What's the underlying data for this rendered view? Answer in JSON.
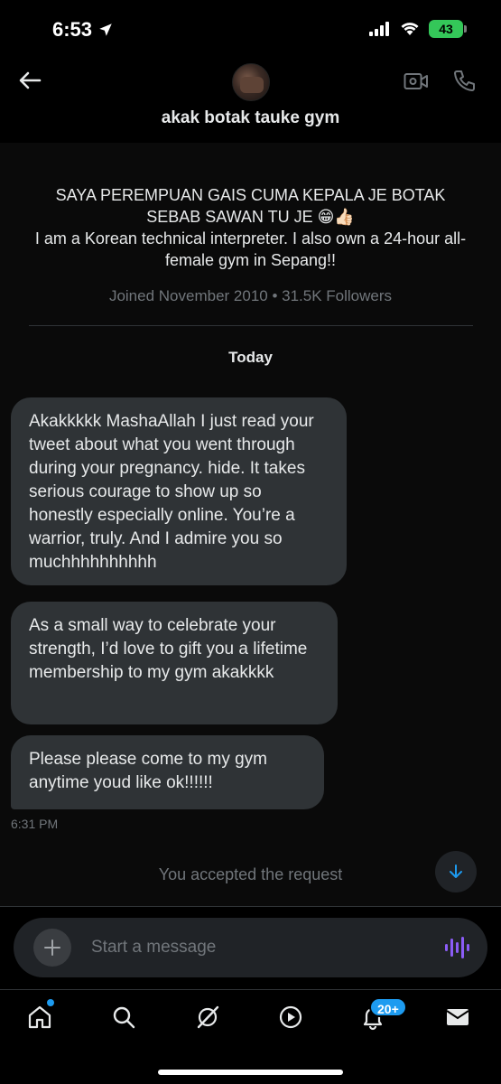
{
  "status_bar": {
    "time": "6:53",
    "battery": "43"
  },
  "header": {
    "title": "akak botak tauke gym"
  },
  "profile": {
    "bio": "SAYA PEREMPUAN GAIS CUMA KEPALA JE BOTAK SEBAB SAWAN TU JE 😁👍🏻\nI am a Korean technical interpreter. I also own a 24-hour all-female gym in Sepang!!",
    "meta": "Joined November 2010 • 31.5K Followers"
  },
  "conversation": {
    "date_label": "Today",
    "messages": [
      {
        "text": "Akakkkkk MashaAllah I just read your tweet about what you went through during your pregnancy. hide. It takes serious courage to show up so honestly especially online. You’re a warrior, truly. And I admire you so muchhhhhhhhhh"
      },
      {
        "text": "As a small way to celebrate your strength, I’d love to gift you a lifetime membership to my gym akakkkk"
      },
      {
        "text": "Please please come to my gym anytime youd like ok!!!!!!"
      }
    ],
    "timestamp": "6:31 PM",
    "system_notice": "You accepted the request"
  },
  "composer": {
    "placeholder": "Start a message"
  },
  "tab_bar": {
    "notifications_badge": "20+"
  },
  "colors": {
    "accent": "#1d9bf0",
    "bubble": "#2f3336",
    "voice": "#8b5cf6"
  }
}
